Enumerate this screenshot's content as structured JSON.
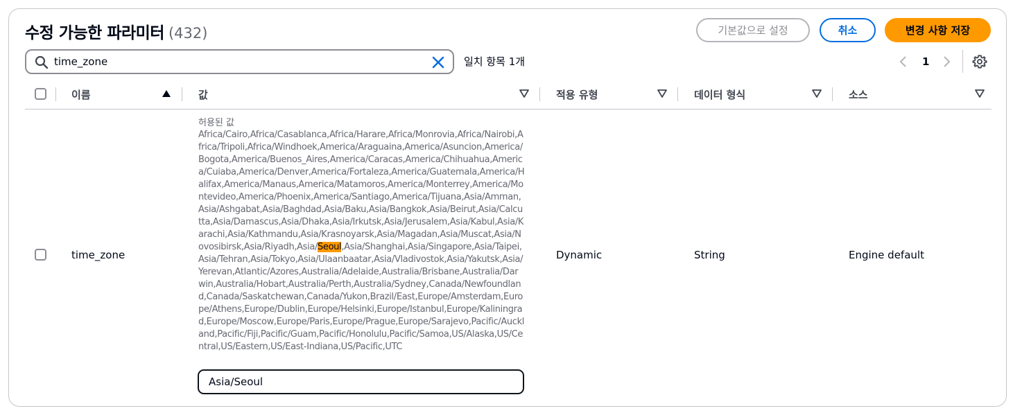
{
  "header": {
    "title": "수정 가능한 파라미터",
    "count": "(432)",
    "reset_label": "기본값으로 설정",
    "cancel_label": "취소",
    "save_label": "변경 사항 저장"
  },
  "search": {
    "value": "time_zone",
    "match_count": "일치 항목 1개"
  },
  "pagination": {
    "current_page": "1"
  },
  "table": {
    "columns": [
      "이름",
      "값",
      "적용 유형",
      "데이터 형식",
      "소스"
    ],
    "rows": [
      {
        "name": "time_zone",
        "allowed_label": "허용된 값",
        "allowed_before": "Africa/Cairo,Africa/Casablanca,Africa/Harare,Africa/Monrovia,Africa/Nairobi,Africa/Tripoli,Africa/Windhoek,America/Araguaina,America/Asuncion,America/Bogota,America/Buenos_Aires,America/Caracas,America/Chihuahua,America/Cuiaba,America/Denver,America/Fortaleza,America/Guatemala,America/Halifax,America/Manaus,America/Matamoros,America/Monterrey,America/Montevideo,America/Phoenix,America/Santiago,America/Tijuana,Asia/Amman,Asia/Ashgabat,Asia/Baghdad,Asia/Baku,Asia/Bangkok,Asia/Beirut,Asia/Calcutta,Asia/Damascus,Asia/Dhaka,Asia/Irkutsk,Asia/Jerusalem,Asia/Kabul,Asia/Karachi,Asia/Kathmandu,Asia/Krasnoyarsk,Asia/Magadan,Asia/Muscat,Asia/Novosibirsk,Asia/Riyadh,Asia/",
        "allowed_highlight": "Seoul",
        "allowed_after": ",Asia/Shanghai,Asia/Singapore,Asia/Taipei,Asia/Tehran,Asia/Tokyo,Asia/Ulaanbaatar,Asia/Vladivostok,Asia/Yakutsk,Asia/Yerevan,Atlantic/Azores,Australia/Adelaide,Australia/Brisbane,Australia/Darwin,Australia/Hobart,Australia/Perth,Australia/Sydney,Canada/Newfoundland,Canada/Saskatchewan,Canada/Yukon,Brazil/East,Europe/Amsterdam,Europe/Athens,Europe/Dublin,Europe/Helsinki,Europe/Istanbul,Europe/Kaliningrad,Europe/Moscow,Europe/Paris,Europe/Prague,Europe/Sarajevo,Pacific/Auckland,Pacific/Fiji,Pacific/Guam,Pacific/Honolulu,Pacific/Samoa,US/Alaska,US/Central,US/Eastern,US/East-Indiana,US/Pacific,UTC",
        "value": "Asia/Seoul",
        "apply_type": "Dynamic",
        "data_type": "String",
        "source": "Engine default"
      }
    ]
  },
  "colors": {
    "primary": "#006ce0",
    "accent": "#ff9900",
    "border": "#c6c6cd",
    "text_secondary": "#656871"
  },
  "icons": [
    "search-icon",
    "clear-icon",
    "chevron-left-icon",
    "chevron-right-icon",
    "settings-icon",
    "sort-ascending-icon",
    "sort-icon"
  ]
}
